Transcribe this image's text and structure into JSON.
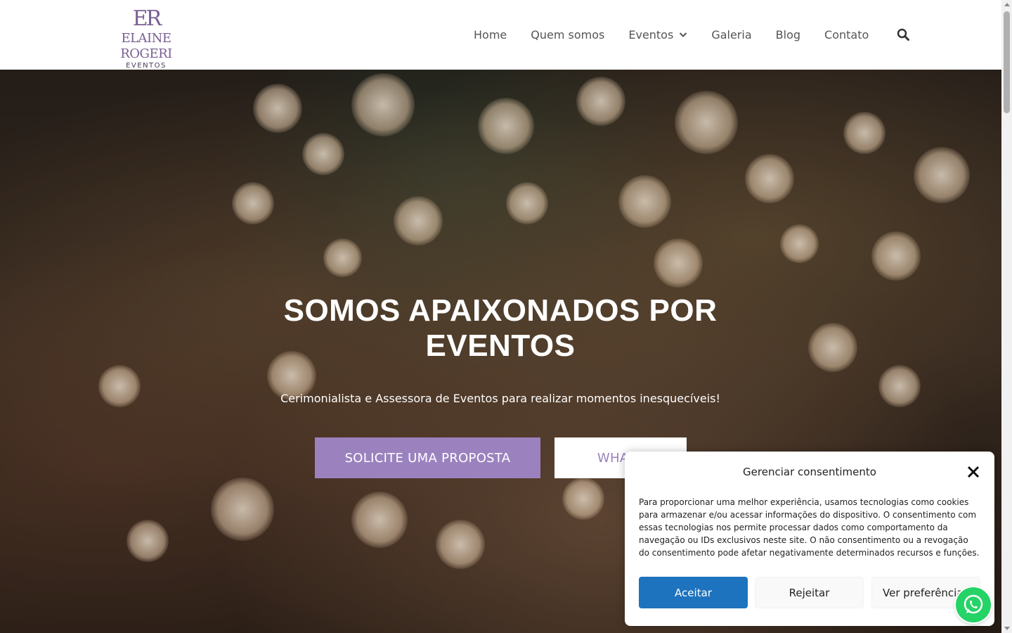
{
  "brand": {
    "monogram": "ER",
    "name": "ELAINE ROGERI",
    "subtitle": "EVENTOS",
    "color": "#7a5f92"
  },
  "nav": {
    "items": [
      {
        "label": "Home"
      },
      {
        "label": "Quem somos"
      },
      {
        "label": "Eventos",
        "has_dropdown": true
      },
      {
        "label": "Galeria"
      },
      {
        "label": "Blog"
      },
      {
        "label": "Contato"
      }
    ],
    "search_icon": "search-icon"
  },
  "hero": {
    "title_line1": "SOMOS APAIXONADOS POR",
    "title_line2": "EVENTOS",
    "subtitle": "Cerimonialista e Assessora de Eventos para realizar momentos inesquecíveis!",
    "primary_button": "SOLICITE UMA PROPOSTA",
    "secondary_button": "WHATS",
    "accent_color": "#9b82bf"
  },
  "consent": {
    "title": "Gerenciar consentimento",
    "text": "Para proporcionar uma melhor experiência, usamos tecnologias como cookies para armazenar e/ou acessar informações do dispositivo. O consentimento com essas tecnologias nos permite processar dados como comportamento da navegação ou IDs exclusivos neste site. O não consentimento ou a revogação do consentimento pode afetar negativamente determinados recursos e funções.",
    "accept": "Aceitar",
    "reject": "Rejeitar",
    "preferences": "Ver preferências",
    "accept_color": "#1e73be"
  },
  "whatsapp": {
    "icon": "whatsapp-icon",
    "color": "#25d366"
  }
}
